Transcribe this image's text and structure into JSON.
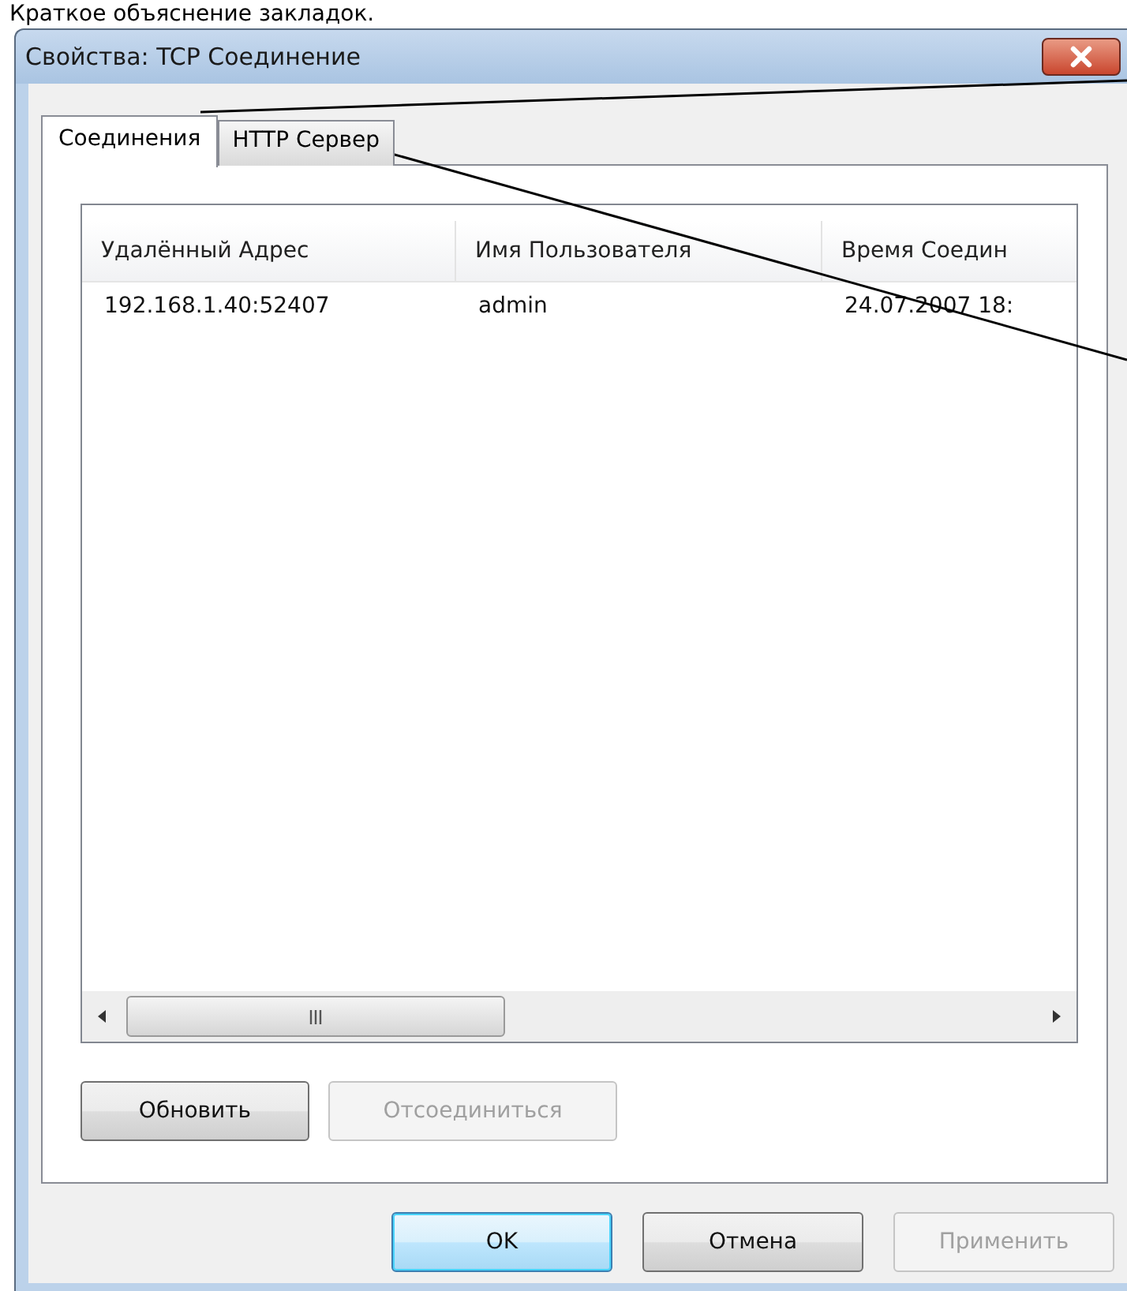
{
  "caption": "Краткое объяснение закладок.",
  "window": {
    "title": "Свойства: TCP Соединение"
  },
  "tabs": [
    {
      "label": "Соединения",
      "selected": true
    },
    {
      "label": "HTTP Сервер",
      "selected": false
    }
  ],
  "table": {
    "columns": [
      "Удалённый Адрес",
      "Имя Пользователя",
      "Время Соедин"
    ],
    "rows": [
      [
        "192.168.1.40:52407",
        "admin",
        "24.07.2007 18:"
      ]
    ]
  },
  "panel_buttons": [
    {
      "label": "Обновить",
      "disabled": false
    },
    {
      "label": "Отсоединиться",
      "disabled": true
    }
  ],
  "buttons": [
    {
      "label": "OK",
      "disabled": false,
      "default": true
    },
    {
      "label": "Отмена",
      "disabled": false,
      "default": false
    },
    {
      "label": "Применить",
      "disabled": true,
      "default": false
    }
  ]
}
